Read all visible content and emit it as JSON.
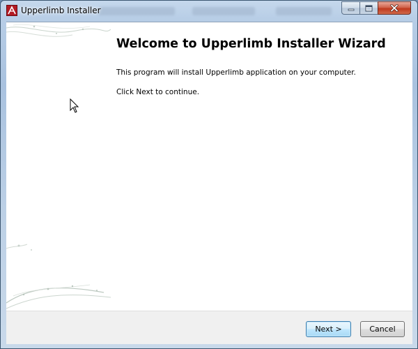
{
  "window": {
    "title": "Upperlimb Installer"
  },
  "content": {
    "heading": "Welcome to Upperlimb Installer Wizard",
    "paragraph1": "This program will install Upperlimb application on your computer.",
    "paragraph2": "Click Next to continue."
  },
  "footer": {
    "next_label": "Next >",
    "cancel_label": "Cancel"
  },
  "icons": {
    "app": "upperlimb-app-icon",
    "minimize": "minimize-icon",
    "maximize": "maximize-icon",
    "close": "close-icon",
    "cursor": "mouse-pointer-icon"
  },
  "colors": {
    "close_button": "#c0391e",
    "next_button_border": "#3c7fb1",
    "window_frame": "#b7cde6"
  }
}
